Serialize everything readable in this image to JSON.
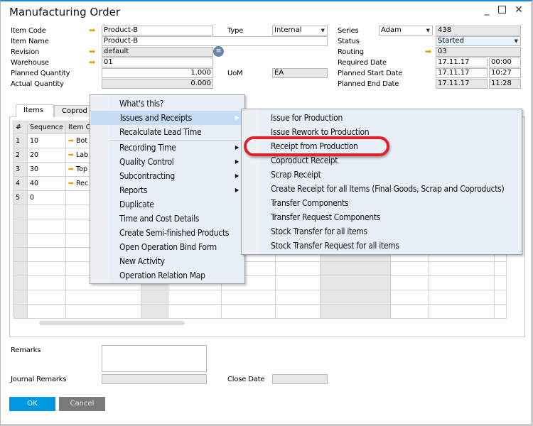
{
  "window": {
    "title": "Manufacturing Order",
    "controls": [
      "minimize",
      "maximize",
      "close"
    ]
  },
  "header": {
    "item_code": {
      "label": "Item Code",
      "value": "Product-B"
    },
    "item_name": {
      "label": "Item Name",
      "value": "Product-B"
    },
    "revision": {
      "label": "Revision",
      "value": "default"
    },
    "warehouse": {
      "label": "Warehouse",
      "value": "01"
    },
    "planned_quantity": {
      "label": "Planned Quantity",
      "value": "1.000"
    },
    "actual_quantity": {
      "label": "Actual Quantity",
      "value": "0.000"
    },
    "type": {
      "label": "Type",
      "value": "Internal"
    },
    "uom": {
      "label": "UoM",
      "value": "EA"
    },
    "series": {
      "label": "Series",
      "value": "Adam",
      "number": "438"
    },
    "status": {
      "label": "Status",
      "value": "Started"
    },
    "routing": {
      "label": "Routing",
      "value": "03"
    },
    "required_date": {
      "label": "Required Date",
      "date": "17.11.17",
      "time": "00:00"
    },
    "planned_start": {
      "label": "Planned Start Date",
      "date": "17.11.17",
      "time": "10:27"
    },
    "planned_end": {
      "label": "Planned End Date",
      "date": "17.11.17",
      "time": "11:28"
    }
  },
  "tabs": [
    {
      "label": "Items"
    },
    {
      "label": "Coprod"
    }
  ],
  "grid": {
    "headers": [
      "#",
      "Sequence",
      "Item C"
    ],
    "rows": [
      {
        "num": "1",
        "seq": "10",
        "item": "Bot"
      },
      {
        "num": "2",
        "seq": "20",
        "item": "Lab"
      },
      {
        "num": "3",
        "seq": "30",
        "item": "Top"
      },
      {
        "num": "4",
        "seq": "40",
        "item": "Rec"
      },
      {
        "num": "5",
        "seq": "0",
        "item": ""
      }
    ]
  },
  "context_menu": {
    "items": [
      {
        "label": "What's this?"
      },
      {
        "label": "Issues and Receipts",
        "submenu": true,
        "highlighted": true
      },
      {
        "label": "Recalculate Lead Time"
      },
      {
        "label": "Recording Time",
        "submenu": true
      },
      {
        "label": "Quality Control",
        "submenu": true
      },
      {
        "label": "Subcontracting",
        "submenu": true
      },
      {
        "label": "Reports",
        "submenu": true
      },
      {
        "label": "Duplicate"
      },
      {
        "label": "Time and Cost Details"
      },
      {
        "label": "Create Semi-finished Products"
      },
      {
        "label": "Open Operation Bind Form"
      },
      {
        "label": "New Activity"
      },
      {
        "label": "Operation Relation Map"
      }
    ]
  },
  "submenu": {
    "items": [
      {
        "label": "Issue for Production"
      },
      {
        "label": "Issue Rework to Production"
      },
      {
        "label": "Receipt from Production",
        "circled": true
      },
      {
        "label": "Coproduct Receipt"
      },
      {
        "label": "Scrap Receipt"
      },
      {
        "label": "Create Receipt for all Items (Final Goods, Scrap and Coproducts)"
      },
      {
        "label": "Transfer Components"
      },
      {
        "label": "Transfer Request Components"
      },
      {
        "label": "Stock Transfer for all items"
      },
      {
        "label": "Stock Transfer Request for all items"
      }
    ]
  },
  "footer": {
    "remarks": {
      "label": "Remarks",
      "value": ""
    },
    "journal_remarks": {
      "label": "Journal Remarks",
      "value": ""
    },
    "close_date": {
      "label": "Close Date",
      "value": ""
    },
    "ok_label": "OK",
    "cancel_label": "Cancel"
  },
  "colors": {
    "accent": "#0099e0",
    "highlight_circle": "#e0222a",
    "arrow": "#e8a200",
    "menu_bg": "#e9eff6",
    "menu_highlight": "#c6dcf5"
  }
}
